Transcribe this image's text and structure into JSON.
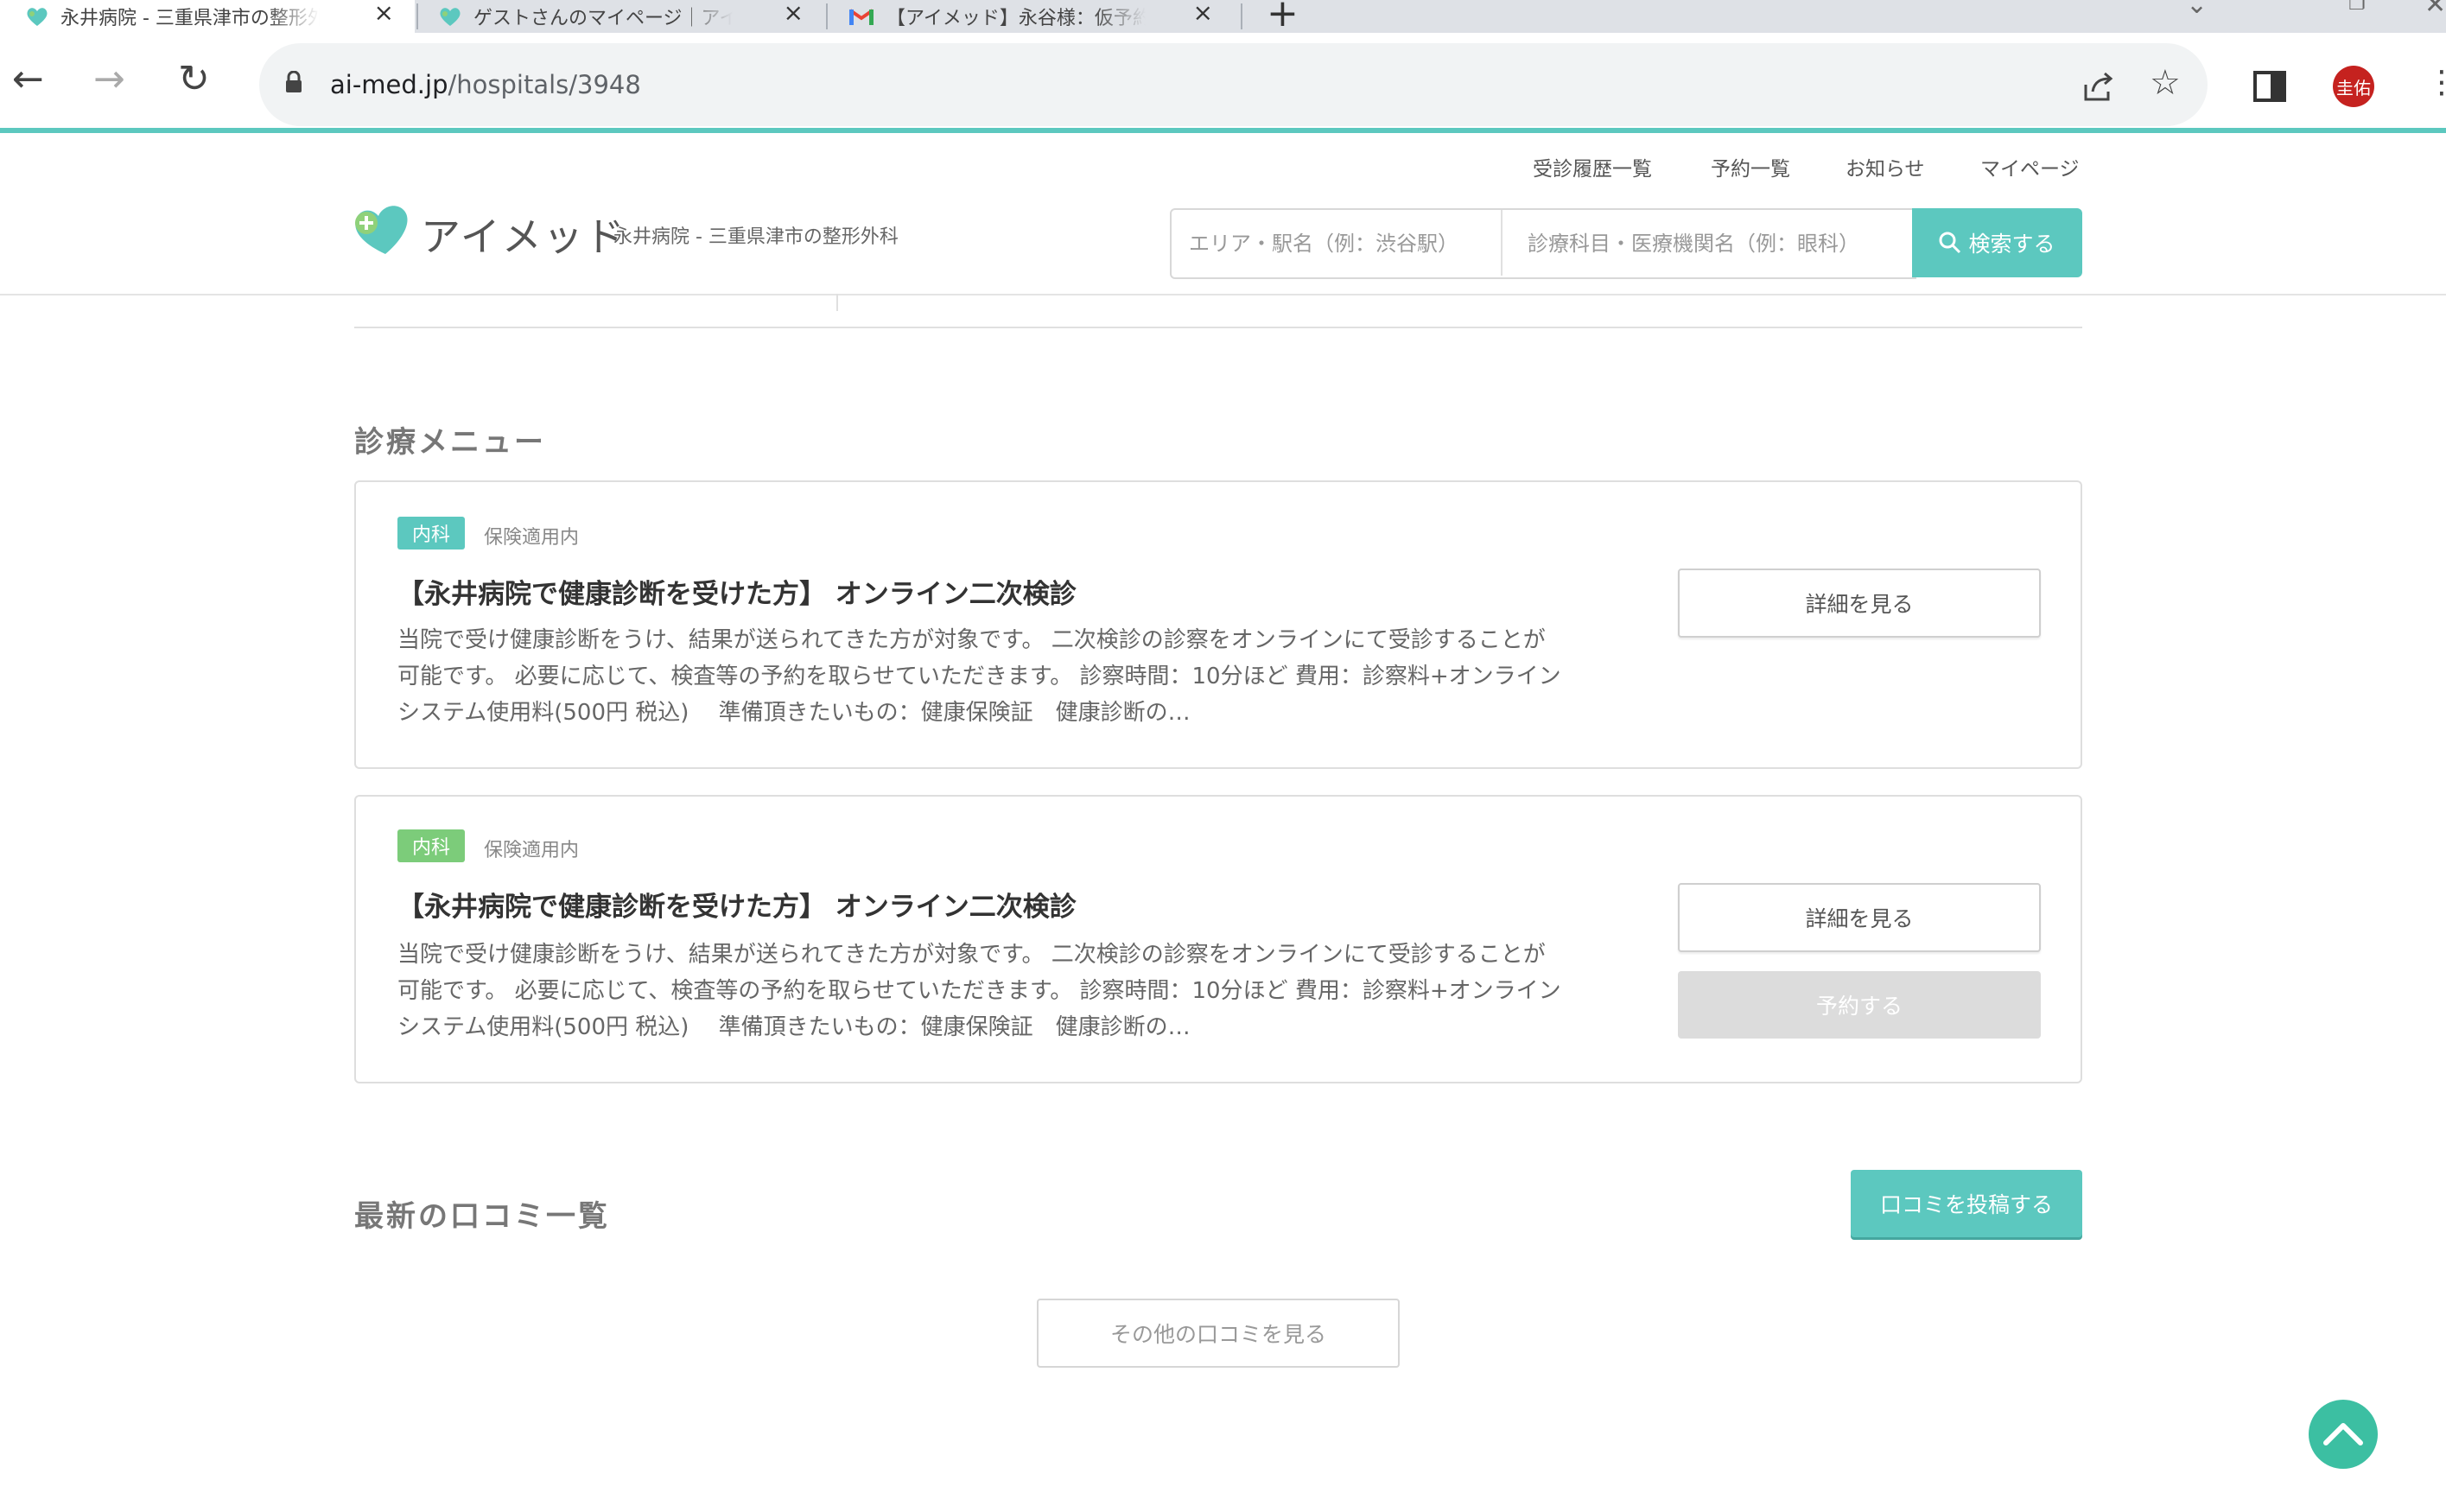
{
  "browser": {
    "tabs": [
      {
        "title": "永井病院 - 三重県津市の整形外科",
        "active": true,
        "icon": "aimed-heart-favicon"
      },
      {
        "title": "ゲストさんのマイページ｜アイメッド",
        "active": false,
        "icon": "aimed-heart-favicon"
      },
      {
        "title": "【アイメッド】永谷様：仮予約承認",
        "active": false,
        "icon": "gmail-favicon"
      }
    ],
    "new_tab_label": "+",
    "url_host": "ai-med.jp",
    "url_path": "/hospitals/3948",
    "profile_initials": "圭佑"
  },
  "header": {
    "nav_links": [
      "受診履歴一覧",
      "予約一覧",
      "お知らせ",
      "マイページ"
    ],
    "logo_text": "アイメッド",
    "logo_subtitle": "永井病院 - 三重県津市の整形外科",
    "search_area_placeholder": "エリア・駅名（例：渋谷駅）",
    "search_keyword_placeholder": "診療科目・医療機関名（例：眼科）",
    "search_button_label": "検索する"
  },
  "menu_section": {
    "title": "診療メニュー",
    "cards": [
      {
        "badge": "内科",
        "insurance": "保険適用内",
        "title": "【永井病院で健康診断を受けた方】 オンライン二次検診",
        "description": "当院で受け健康診断をうけ、結果が送られてきた方が対象です。 二次検診の診察をオンラインにて受診することが可能です。 必要に応じて、検査等の予約を取らせていただきます。 診察時間：10分ほど 費用：診察料+オンラインシステム使用料(500円 税込)　 準備頂きたいもの：健康保険証　健康診断の…",
        "detail_button": "詳細を見る"
      },
      {
        "badge": "内科",
        "insurance": "保険適用内",
        "title": "【永井病院で健康診断を受けた方】 オンライン二次検診",
        "description": "当院で受け健康診断をうけ、結果が送られてきた方が対象です。 二次検診の診察をオンラインにて受診することが可能です。 必要に応じて、検査等の予約を取らせていただきます。 診察時間：10分ほど 費用：診察料+オンラインシステム使用料(500円 税込)　 準備頂きたいもの：健康保険証　健康診断の…",
        "detail_button": "詳細を見る",
        "reserve_button": "予約する"
      }
    ]
  },
  "reviews_section": {
    "title": "最新の口コミ一覧",
    "post_button": "口コミを投稿する",
    "more_button": "その他の口コミを見る"
  },
  "colors": {
    "accent": "#5cc8bf",
    "badge_green": "#7ccc7a",
    "scroll_top": "#3cbfa2"
  }
}
